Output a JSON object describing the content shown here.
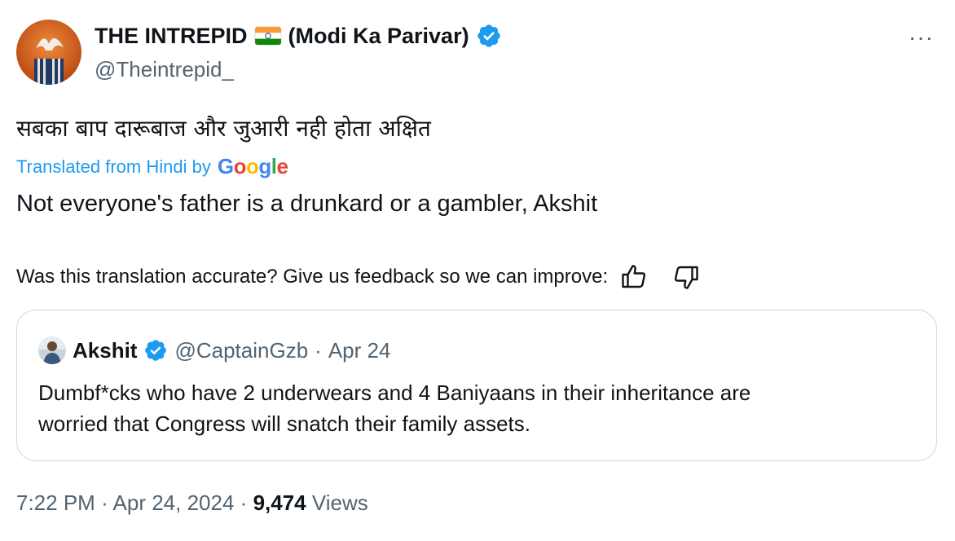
{
  "author": {
    "display_name": "THE INTREPID",
    "party_tag": "(Modi Ka Parivar)",
    "handle": "@Theintrepid_",
    "avatar_text": "THE INTREPID",
    "flag_icon": "india-flag-icon",
    "verified_icon": "verified-badge-icon"
  },
  "more_label": "···",
  "tweet": {
    "hindi_text": "सबका बाप दारूबाज और जुआरी नही होता अक्षित",
    "translated_label": "Translated from Hindi by",
    "translator_logo": "Google",
    "translation_text": "Not everyone's father is a drunkard or a gambler, Akshit",
    "feedback_prompt": "Was this translation accurate? Give us feedback so we can improve:"
  },
  "quote": {
    "name": "Akshit",
    "handle": "@CaptainGzb",
    "separator": "·",
    "date": "Apr 24",
    "line1": "Dumbf*cks who have 2 underwears and 4 Baniyaans in their inheritance are",
    "line2": "worried that Congress will snatch their family assets."
  },
  "footer": {
    "time": "7:22 PM",
    "sep1": "·",
    "date": "Apr 24, 2024",
    "sep2": "·",
    "views_count": "9,474",
    "views_label": "Views"
  },
  "colors": {
    "accent": "#1d9bf0",
    "text": "#0f1419",
    "muted": "#536471",
    "border": "#cfd9de"
  }
}
